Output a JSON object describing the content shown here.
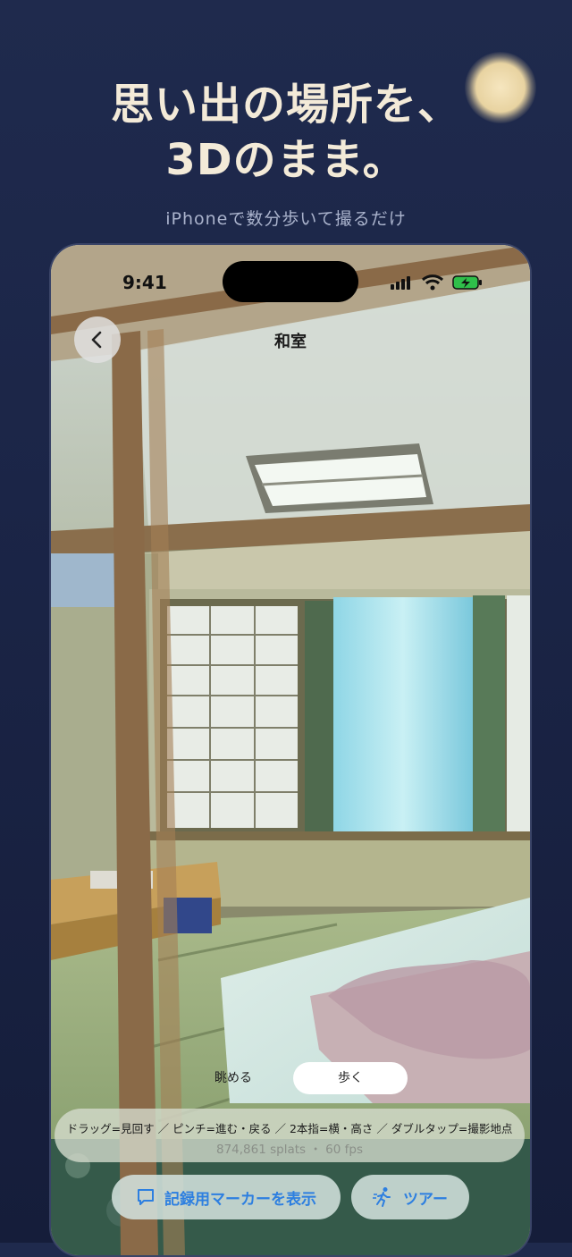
{
  "promo": {
    "headline_line1": "思い出の場所を、",
    "headline_line2": "3Dのまま。",
    "subtitle": "iPhoneで数分歩いて撮るだけ"
  },
  "status": {
    "time": "9:41"
  },
  "viewer": {
    "title": "和室",
    "modes": [
      "眺める",
      "歩く"
    ],
    "selected_mode": "歩く",
    "help_text": "ドラッグ=見回す ／ ピンチ=進む・戻る ／ 2本指=横・高さ ／ ダブルタップ=撮影地点",
    "stats_text": "874,861 splats ・ 60 fps",
    "marker_button": "記録用マーカーを表示",
    "tour_button": "ツアー"
  },
  "colors": {
    "accent": "#2d7fe0",
    "background": "#1b2547",
    "headline": "#f3ead8"
  }
}
